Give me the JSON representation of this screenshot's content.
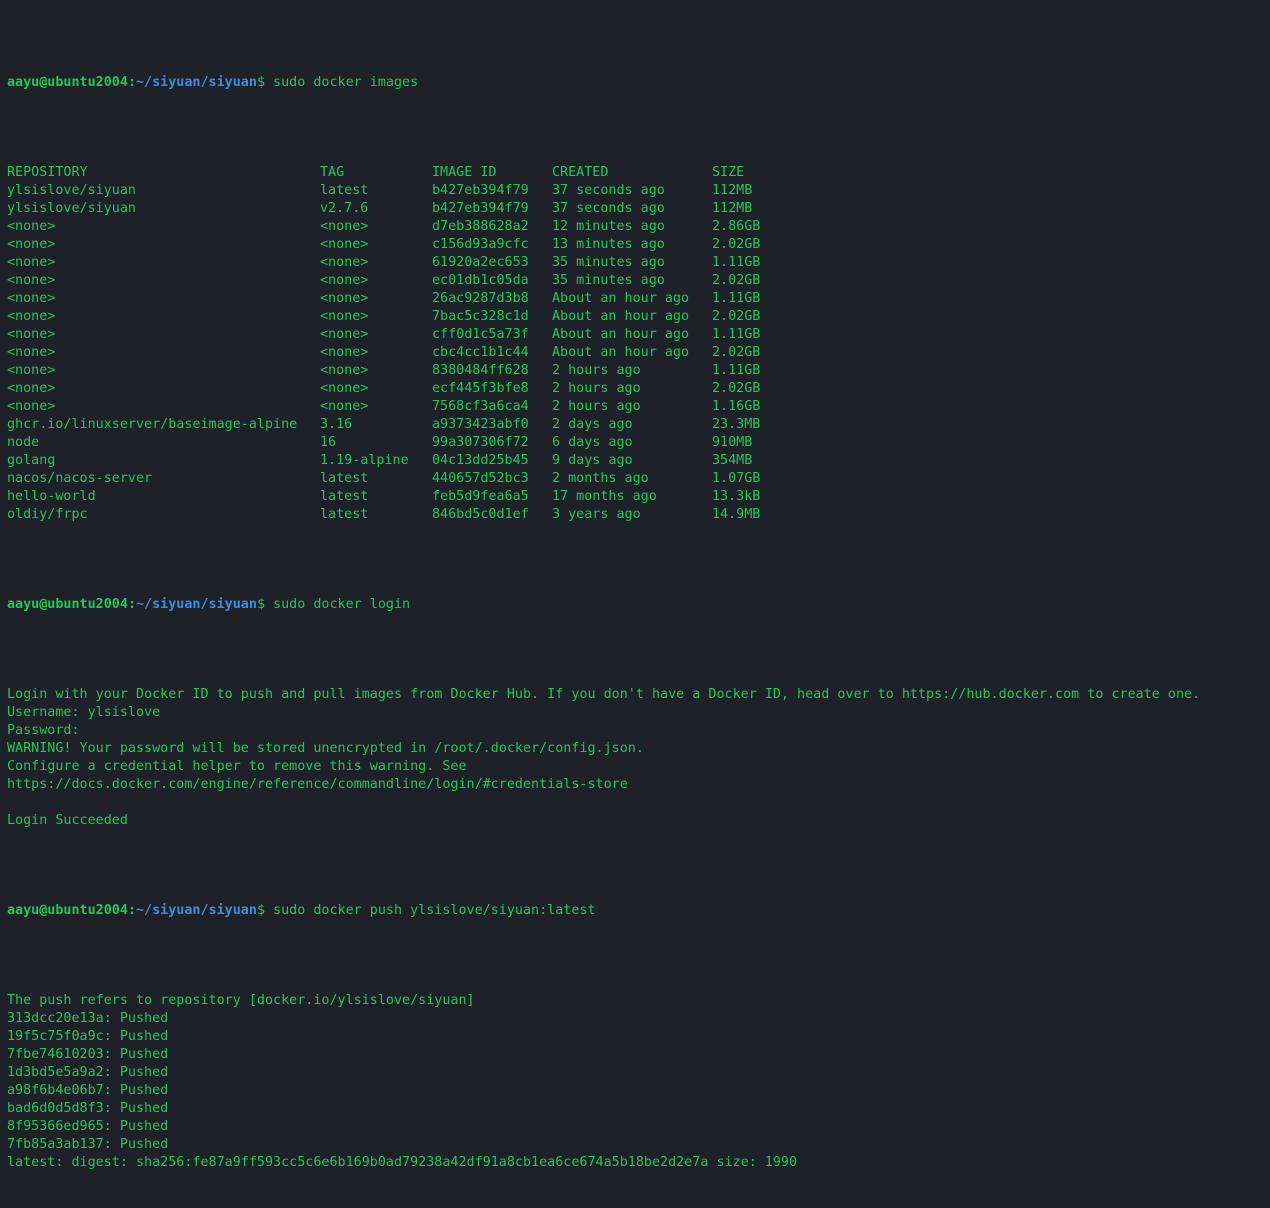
{
  "prompt": {
    "user_host": "aayu@ubuntu2004",
    "separator": ":",
    "path": "~/siyuan/siyuan",
    "dollar": "$"
  },
  "commands": {
    "images": " sudo docker images",
    "login": " sudo docker login",
    "push": " sudo docker push ylsislove/siyuan:latest"
  },
  "images_table": {
    "headers": [
      "REPOSITORY",
      "TAG",
      "IMAGE ID",
      "CREATED",
      "SIZE"
    ],
    "rows": [
      [
        "ylsislove/siyuan",
        "latest",
        "b427eb394f79",
        "37 seconds ago",
        "112MB"
      ],
      [
        "ylsislove/siyuan",
        "v2.7.6",
        "b427eb394f79",
        "37 seconds ago",
        "112MB"
      ],
      [
        "<none>",
        "<none>",
        "d7eb388628a2",
        "12 minutes ago",
        "2.86GB"
      ],
      [
        "<none>",
        "<none>",
        "c156d93a9cfc",
        "13 minutes ago",
        "2.02GB"
      ],
      [
        "<none>",
        "<none>",
        "61920a2ec653",
        "35 minutes ago",
        "1.11GB"
      ],
      [
        "<none>",
        "<none>",
        "ec01db1c05da",
        "35 minutes ago",
        "2.02GB"
      ],
      [
        "<none>",
        "<none>",
        "26ac9287d3b8",
        "About an hour ago",
        "1.11GB"
      ],
      [
        "<none>",
        "<none>",
        "7bac5c328c1d",
        "About an hour ago",
        "2.02GB"
      ],
      [
        "<none>",
        "<none>",
        "cff0d1c5a73f",
        "About an hour ago",
        "1.11GB"
      ],
      [
        "<none>",
        "<none>",
        "cbc4cc1b1c44",
        "About an hour ago",
        "2.02GB"
      ],
      [
        "<none>",
        "<none>",
        "8380484ff628",
        "2 hours ago",
        "1.11GB"
      ],
      [
        "<none>",
        "<none>",
        "ecf445f3bfe8",
        "2 hours ago",
        "2.02GB"
      ],
      [
        "<none>",
        "<none>",
        "7568cf3a6ca4",
        "2 hours ago",
        "1.16GB"
      ],
      [
        "ghcr.io/linuxserver/baseimage-alpine",
        "3.16",
        "a9373423abf0",
        "2 days ago",
        "23.3MB"
      ],
      [
        "node",
        "16",
        "99a307306f72",
        "6 days ago",
        "910MB"
      ],
      [
        "golang",
        "1.19-alpine",
        "04c13dd25b45",
        "9 days ago",
        "354MB"
      ],
      [
        "nacos/nacos-server",
        "latest",
        "440657d52bc3",
        "2 months ago",
        "1.07GB"
      ],
      [
        "hello-world",
        "latest",
        "feb5d9fea6a5",
        "17 months ago",
        "13.3kB"
      ],
      [
        "oldiy/frpc",
        "latest",
        "846bd5c0d1ef",
        "3 years ago",
        "14.9MB"
      ]
    ]
  },
  "login_output": [
    "Login with your Docker ID to push and pull images from Docker Hub. If you don't have a Docker ID, head over to https://hub.docker.com to create one.",
    "Username: ylsislove",
    "Password:",
    "WARNING! Your password will be stored unencrypted in /root/.docker/config.json.",
    "Configure a credential helper to remove this warning. See",
    "https://docs.docker.com/engine/reference/commandline/login/#credentials-store",
    "",
    "Login Succeeded"
  ],
  "push_output": [
    "The push refers to repository [docker.io/ylsislove/siyuan]",
    "313dcc20e13a: Pushed",
    "19f5c75f0a9c: Pushed",
    "7fbe74610203: Pushed",
    "1d3bd5e5a9a2: Pushed",
    "a98f6b4e06b7: Pushed",
    "bad6d0d5d8f3: Pushed",
    "8f95366ed965: Pushed",
    "7fb85a3ab137: Pushed",
    "latest: digest: sha256:fe87a9ff593cc5c6e6b169b0ad79238a42df91a8cb1ea6ce674a5b18be2d2e7a size: 1990"
  ],
  "colors": {
    "background": "#1e2127",
    "text_green": "#1ec95a",
    "path_blue": "#3a8fe0"
  }
}
